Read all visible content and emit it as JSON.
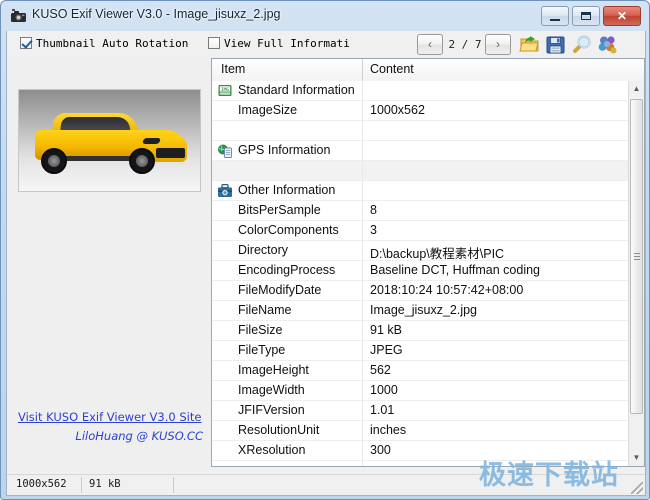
{
  "window": {
    "title": "KUSO Exif Viewer V3.0 - Image_jisuxz_2.jpg",
    "icon": "camera-icon",
    "buttons": {
      "minimize": "minimize",
      "maximize": "maximize",
      "close": "✕"
    }
  },
  "toolbar": {
    "thumbnail_rotation_label": "Thumbnail Auto Rotation",
    "thumbnail_rotation_checked": true,
    "view_full_label": "View Full Informati",
    "view_full_checked": false,
    "prev_glyph": "‹",
    "next_glyph": "›",
    "page_indicator": "2 / 7",
    "icons": {
      "open": "folder-open-icon",
      "save": "save-disk-icon",
      "search": "magnifier-icon",
      "config": "settings-icon"
    }
  },
  "left_panel": {
    "thumbnail_alt": "yellow-sports-suv-thumbnail",
    "link_line_1": "Visit KUSO Exif Viewer V3.0 Site",
    "link_line_2": "LiloHuang @ KUSO.CC"
  },
  "table": {
    "headers": {
      "item": "Item",
      "content": "Content"
    },
    "rows": [
      {
        "type": "category",
        "icon": "img-document-icon",
        "item": "Standard Information",
        "content": ""
      },
      {
        "type": "field",
        "item": "ImageSize",
        "content": "1000x562"
      },
      {
        "type": "blank",
        "item": "",
        "content": ""
      },
      {
        "type": "category",
        "icon": "globe-document-icon",
        "item": "GPS Information",
        "content": ""
      },
      {
        "type": "blank-alt",
        "item": "",
        "content": ""
      },
      {
        "type": "category",
        "icon": "camera-case-icon",
        "item": "Other Information",
        "content": ""
      },
      {
        "type": "field",
        "item": "BitsPerSample",
        "content": "8"
      },
      {
        "type": "field",
        "item": "ColorComponents",
        "content": "3"
      },
      {
        "type": "field",
        "item": "Directory",
        "content": "D:\\backup\\教程素材\\PIC"
      },
      {
        "type": "field",
        "item": "EncodingProcess",
        "content": "Baseline DCT, Huffman coding"
      },
      {
        "type": "field",
        "item": "FileModifyDate",
        "content": "2018:10:24 10:57:42+08:00"
      },
      {
        "type": "field",
        "item": "FileName",
        "content": "Image_jisuxz_2.jpg"
      },
      {
        "type": "field",
        "item": "FileSize",
        "content": "91 kB"
      },
      {
        "type": "field",
        "item": "FileType",
        "content": "JPEG"
      },
      {
        "type": "field",
        "item": "ImageHeight",
        "content": "562"
      },
      {
        "type": "field",
        "item": "ImageWidth",
        "content": "1000"
      },
      {
        "type": "field",
        "item": "JFIFVersion",
        "content": "1.01"
      },
      {
        "type": "field",
        "item": "ResolutionUnit",
        "content": "inches"
      },
      {
        "type": "field",
        "item": "XResolution",
        "content": "300"
      }
    ]
  },
  "scrollbar": {
    "up_glyph": "▲",
    "down_glyph": "▼"
  },
  "status_bar": {
    "dimensions": "1000x562",
    "file_size": "91 kB",
    "extra": ""
  },
  "watermark": {
    "text": "极速下载站",
    "color": "#7fb4e0"
  },
  "colors": {
    "title_gradient_top": "#d3e3f3",
    "close_button": "#bf4130",
    "link_text": "#2b3fd0",
    "panel_bg": "#efefef"
  }
}
